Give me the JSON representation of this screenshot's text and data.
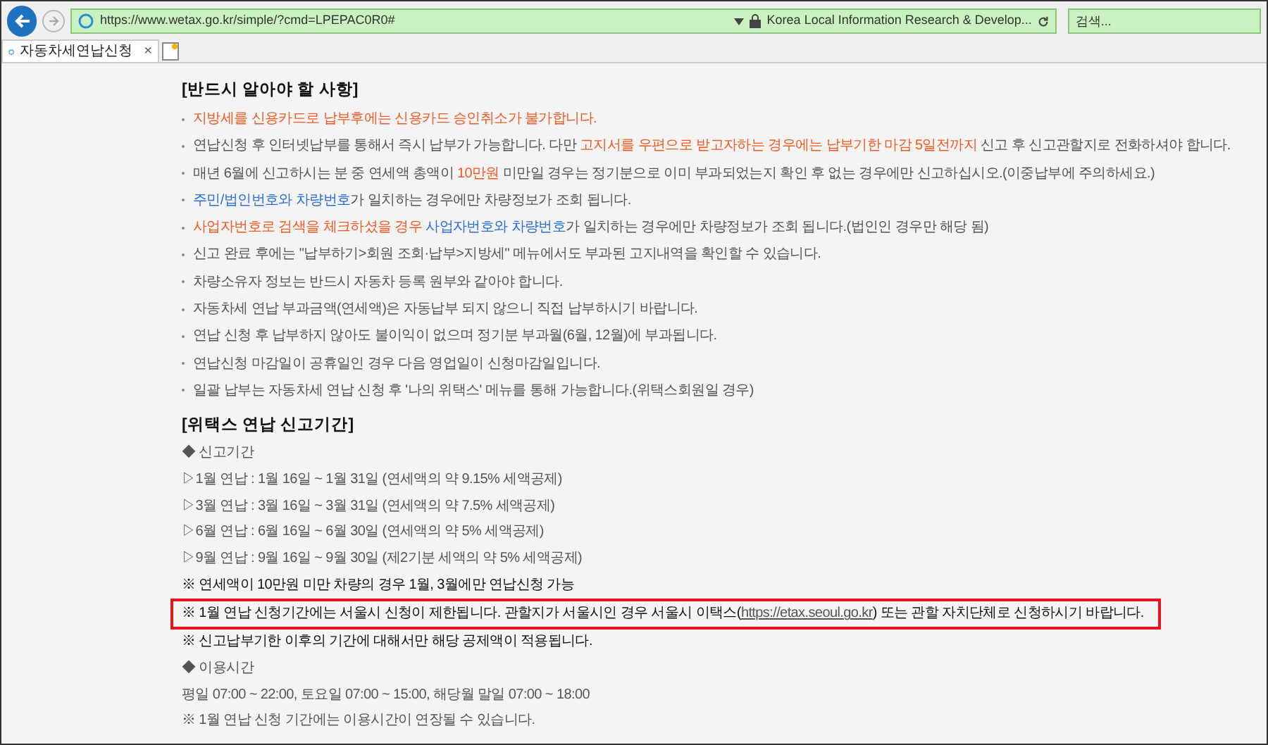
{
  "browser": {
    "address": "https://www.wetax.go.kr/simple/?cmd=LPEPAC0R0#",
    "site_identity": "Korea Local Information Research & Develop...",
    "search_placeholder": "검색...",
    "tab_title": "자동차세연납신청",
    "tab_close": "×"
  },
  "notice": {
    "title": "[반드시 알아야 할 사항]",
    "items": [
      {
        "segments": [
          {
            "kind": "orange",
            "text": "지방세를 신용카드로 납부후에는 신용카드 승인취소가 불가합니다."
          }
        ]
      },
      {
        "segments": [
          {
            "kind": "normal",
            "text": "연납신청 후 인터넷납부를 통해서 즉시 납부가 가능합니다. 다만 "
          },
          {
            "kind": "orange",
            "text": "고지서를 우편으로 받고자하는 경우에는 납부기한 마감 5일전까지"
          },
          {
            "kind": "normal",
            "text": " 신고 후 신고관할지로 전화하셔야 합니다."
          }
        ]
      },
      {
        "segments": [
          {
            "kind": "normal",
            "text": "매년 6월에 신고하시는 분 중 연세액 총액이 "
          },
          {
            "kind": "orange",
            "text": "10만원"
          },
          {
            "kind": "normal",
            "text": " 미만일 경우는 정기분으로 이미 부과되었는지 확인 후 없는 경우에만 신고하십시오.(이중납부에 주의하세요.)"
          }
        ]
      },
      {
        "segments": [
          {
            "kind": "blue",
            "text": "주민/법인번호와 차량번호"
          },
          {
            "kind": "normal",
            "text": "가 일치하는 경우에만 차량정보가 조회 됩니다."
          }
        ]
      },
      {
        "segments": [
          {
            "kind": "orange",
            "text": "사업자번호로 검색을 체크하셨을 경우 "
          },
          {
            "kind": "blue",
            "text": "사업자번호와 차량번호"
          },
          {
            "kind": "normal",
            "text": "가 일치하는 경우에만 차량정보가 조회 됩니다.(법인인 경우만 해당 됨)"
          }
        ]
      },
      {
        "segments": [
          {
            "kind": "normal",
            "text": "신고 완료 후에는 \"납부하기>회원 조회·납부>지방세\" 메뉴에서도 부과된 고지내역을 확인할 수 있습니다."
          }
        ]
      },
      {
        "segments": [
          {
            "kind": "normal",
            "text": "차량소유자 정보는 반드시 자동차 등록 원부와 같아야 합니다."
          }
        ]
      },
      {
        "segments": [
          {
            "kind": "normal",
            "text": "자동차세 연납 부과금액(연세액)은 자동납부 되지 않으니 직접 납부하시기 바랍니다."
          }
        ]
      },
      {
        "segments": [
          {
            "kind": "normal",
            "text": "연납 신청 후 납부하지 않아도 불이익이 없으며 정기분 부과월(6월, 12월)에 부과됩니다."
          }
        ]
      },
      {
        "segments": [
          {
            "kind": "normal",
            "text": "연납신청 마감일이 공휴일인 경우 다음 영업일이 신청마감일입니다."
          }
        ]
      },
      {
        "segments": [
          {
            "kind": "normal",
            "text": "일괄 납부는 자동차세 연납 신청 후 '나의 위택스' 메뉴를 통해 가능합니다.(위택스회원일 경우)"
          }
        ]
      }
    ]
  },
  "period": {
    "title": "[위택스 연납 신고기간]",
    "lines": [
      {
        "kind": "subhead",
        "text": "◆ 신고기간"
      },
      {
        "kind": "plain",
        "text": "▷1월 연납 : 1월 16일 ~ 1월 31일 (연세액의 약 9.15% 세액공제)"
      },
      {
        "kind": "plain",
        "text": "▷3월 연납 : 3월 16일 ~ 3월 31일 (연세액의 약 7.5% 세액공제)"
      },
      {
        "kind": "plain",
        "text": "▷6월 연납 : 6월 16일 ~ 6월 30일 (연세액의 약 5% 세액공제)"
      },
      {
        "kind": "plain",
        "text": "▷9월 연납 : 9월 16일 ~ 9월 30일 (제2기분 세액의 약 5% 세액공제)"
      },
      {
        "kind": "note",
        "text": "※ 연세액이 10만원 미만 차량의 경우 1월, 3월에만 연납신청 가능"
      },
      {
        "kind": "highlight",
        "before": "※ 1월 연납 신청기간에는 서울시 신청이 제한됩니다. 관할지가 서울시인 경우 서울시 이택스(",
        "link": "https://etax.seoul.go.kr",
        "after": ") 또는 관할 자치단체로 신청하시기 바랍니다."
      },
      {
        "kind": "note",
        "text": "※ 신고납부기한 이후의 기간에 대해서만 해당 공제액이 적용됩니다."
      },
      {
        "kind": "subhead",
        "text": "◆ 이용시간"
      },
      {
        "kind": "plain",
        "text": "평일 07:00 ~ 22:00, 토요일 07:00 ~ 15:00, 해당월 말일 07:00 ~ 18:00"
      },
      {
        "kind": "plain",
        "text": "※ 1월 연납 신청 기간에는 이용시간이 연장될 수 있습니다."
      }
    ]
  }
}
